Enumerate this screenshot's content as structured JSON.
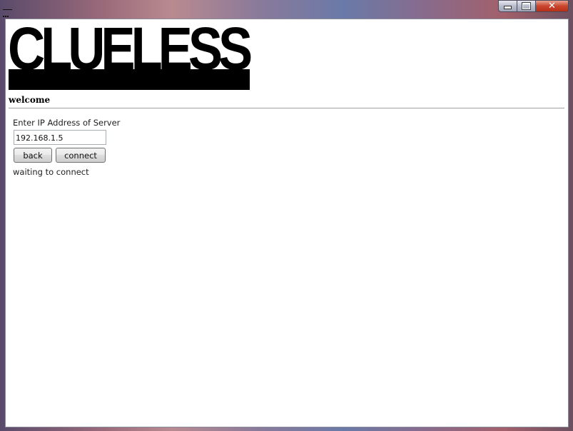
{
  "window": {
    "controls": {
      "minimize_icon": "minimize-icon",
      "maximize_icon": "maximize-icon",
      "close_label": "✕"
    }
  },
  "header": {
    "logo_text": "CLUELESS",
    "section_title": "welcome"
  },
  "connect_form": {
    "ip_label": "Enter IP Address of Server",
    "ip_value": "192.168.1.5",
    "back_label": "back",
    "connect_label": "connect",
    "status_text": "waiting to connect"
  },
  "colors": {
    "background": "#ffffff",
    "logo": "#000000",
    "close_button": "#c8452c"
  }
}
